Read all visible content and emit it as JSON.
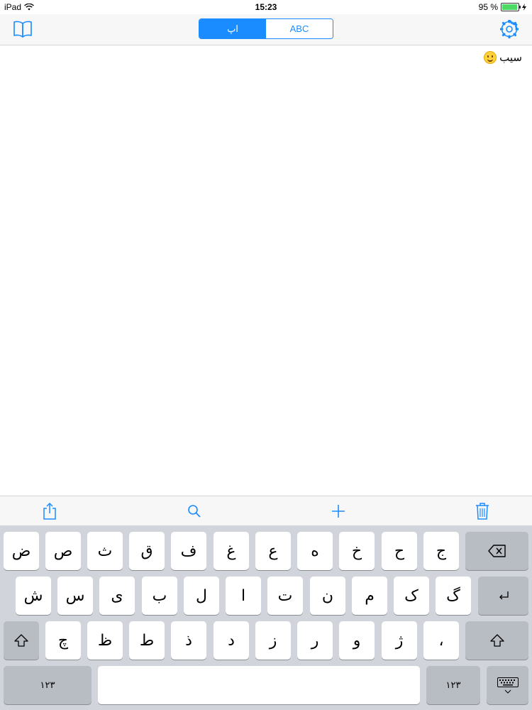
{
  "status_bar": {
    "device": "iPad",
    "time": "15:23",
    "battery": "95 %",
    "battery_level": 0.95,
    "battery_color": "#4cd964"
  },
  "nav": {
    "left_icon": "book-icon",
    "segments": [
      {
        "label": "اپ",
        "active": true
      },
      {
        "label": "ABC",
        "active": false
      }
    ],
    "right_icon": "gear-icon",
    "accent": "#1a8cff"
  },
  "content": {
    "entry_text": "سیب",
    "entry_icon": "smiley-emoji-icon"
  },
  "toolbar": {
    "icons": [
      "share-icon",
      "search-icon",
      "add-icon",
      "trash-icon"
    ]
  },
  "keyboard": {
    "row1": [
      "ض",
      "ص",
      "ث",
      "ق",
      "ف",
      "غ",
      "ع",
      "ه",
      "خ",
      "ح",
      "ج"
    ],
    "row2": [
      "ش",
      "س",
      "ی",
      "ب",
      "ل",
      "ا",
      "ت",
      "ن",
      "م",
      "ک",
      "گ"
    ],
    "row3": [
      "چ",
      "ظ",
      "ط",
      "ذ",
      "د",
      "ز",
      "ر",
      "و",
      "ژ",
      "،"
    ],
    "numbers_label_left": "١٢٣",
    "numbers_label_right": "١٢٣"
  }
}
